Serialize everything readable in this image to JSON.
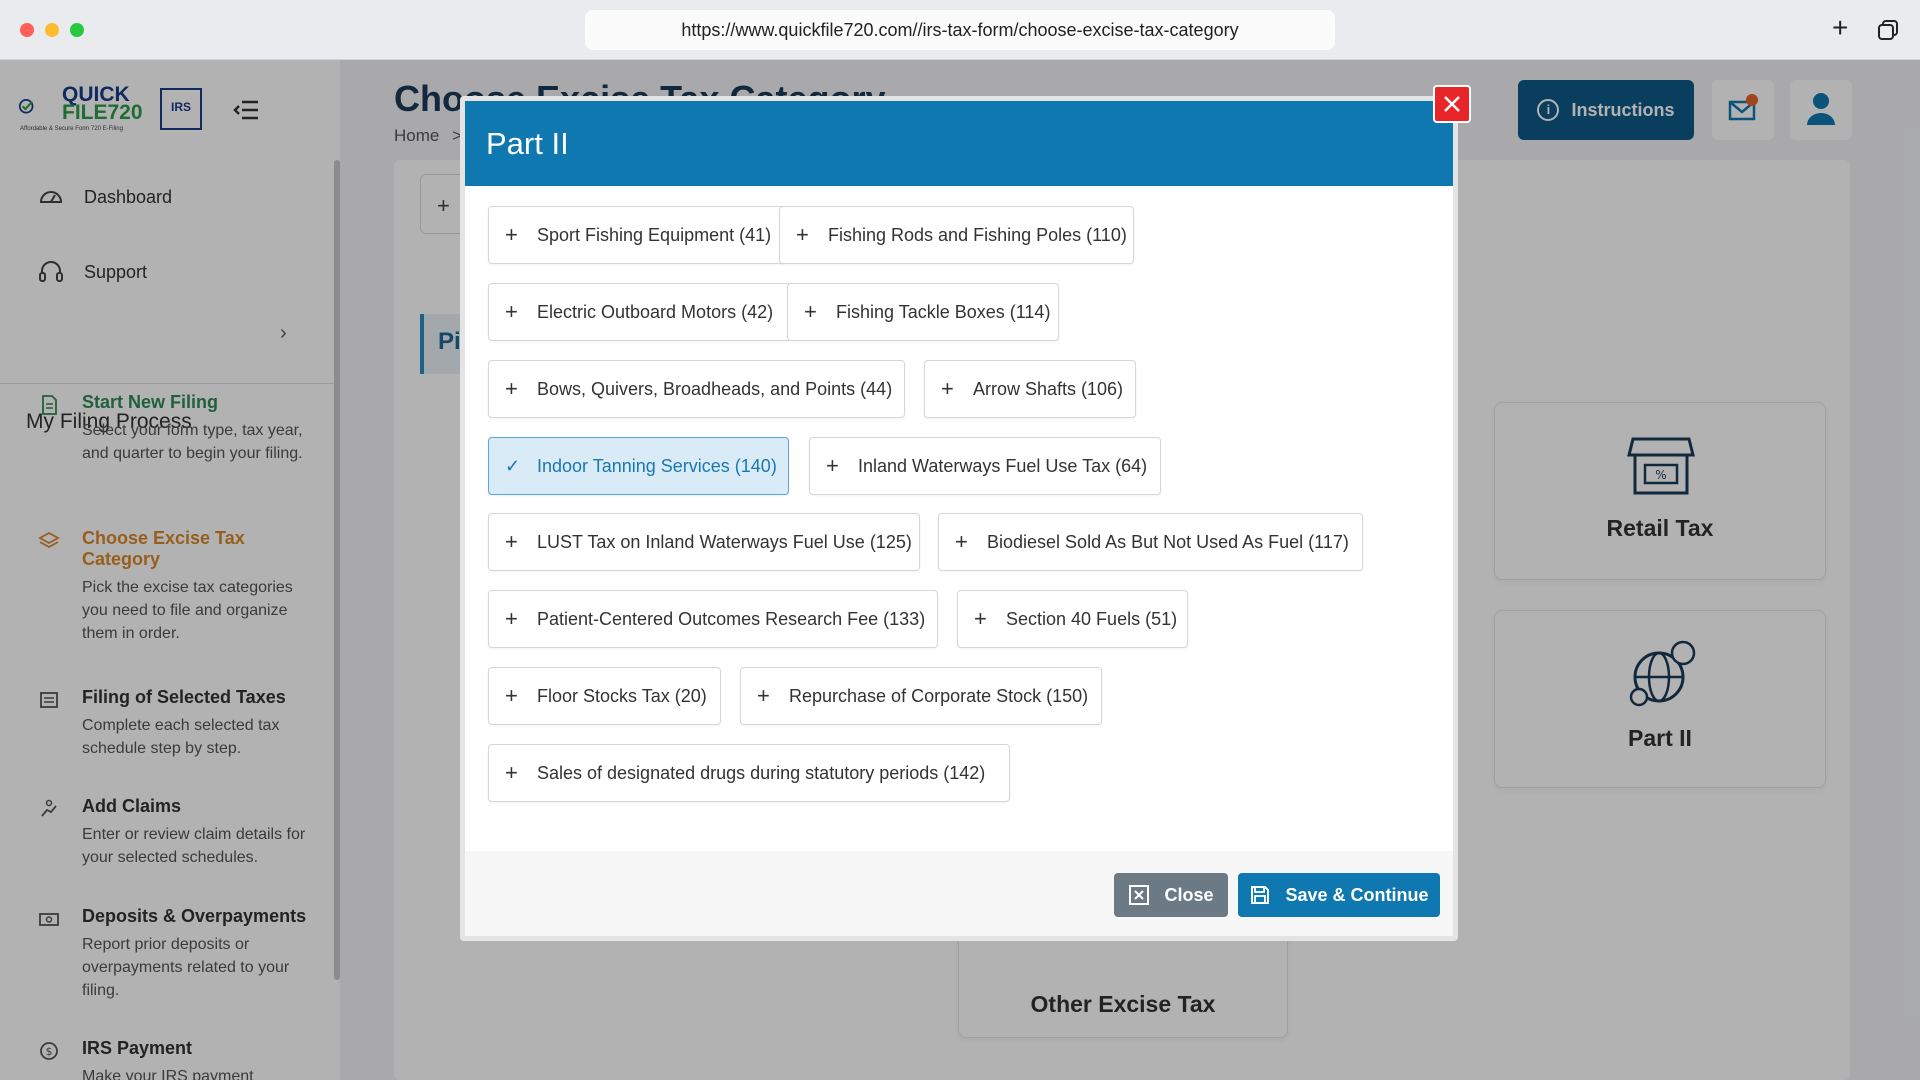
{
  "browser": {
    "url": "https://www.quickfile720.com//irs-tax-form/choose-excise-tax-category"
  },
  "brand": {
    "logo_line1": "QUICK",
    "logo_line2": "FILE720",
    "logo_tagline": "Affordable & Secure Form 720 E-Filing",
    "irs_badge": "IRS"
  },
  "sidebar": {
    "items": [
      {
        "label": "Dashboard",
        "icon": "dashboard-icon"
      },
      {
        "label": "Support",
        "icon": "headset-icon"
      }
    ],
    "process_title": "My Filing Process",
    "steps": [
      {
        "title": "Start New Filing",
        "desc": "Select your form type, tax year, and quarter to begin your filing.",
        "state": "done"
      },
      {
        "title": "Choose Excise Tax Category",
        "desc": "Pick the excise tax categories you need to file and organize them in order.",
        "state": "active"
      },
      {
        "title": "Filing of Selected Taxes",
        "desc": "Complete each selected tax schedule step by step.",
        "state": "pending"
      },
      {
        "title": "Add Claims",
        "desc": "Enter or review claim details for your selected schedules.",
        "state": "pending"
      },
      {
        "title": "Deposits & Overpayments",
        "desc": "Report prior deposits or overpayments related to your filing.",
        "state": "pending"
      },
      {
        "title": "IRS Payment",
        "desc": "Make your IRS payment",
        "state": "pending"
      }
    ]
  },
  "header": {
    "page_title": "Choose Excise Tax Category",
    "breadcrumb_home": "Home",
    "breadcrumb_sep": ">",
    "instructions_label": "Instructions"
  },
  "background": {
    "plus": "+",
    "pi": "Pi",
    "cards": [
      {
        "label": "Retail Tax"
      },
      {
        "label": "Part II"
      },
      {
        "label": "Other Excise Tax"
      }
    ]
  },
  "modal": {
    "title": "Part II",
    "options": [
      {
        "label": "Sport Fishing Equipment (41)",
        "selected": false
      },
      {
        "label": "Fishing Rods and Fishing Poles (110)",
        "selected": false
      },
      {
        "label": "Electric Outboard Motors (42)",
        "selected": false
      },
      {
        "label": "Fishing Tackle Boxes (114)",
        "selected": false
      },
      {
        "label": "Bows, Quivers, Broadheads, and Points (44)",
        "selected": false
      },
      {
        "label": "Arrow Shafts (106)",
        "selected": false
      },
      {
        "label": "Indoor Tanning Services (140)",
        "selected": true
      },
      {
        "label": "Inland Waterways Fuel Use Tax (64)",
        "selected": false
      },
      {
        "label": "LUST Tax on Inland Waterways Fuel Use (125)",
        "selected": false
      },
      {
        "label": "Biodiesel Sold As But Not Used As Fuel (117)",
        "selected": false
      },
      {
        "label": "Patient-Centered Outcomes Research Fee (133)",
        "selected": false
      },
      {
        "label": "Section 40 Fuels (51)",
        "selected": false
      },
      {
        "label": "Floor Stocks Tax (20)",
        "selected": false
      },
      {
        "label": "Repurchase of Corporate Stock (150)",
        "selected": false
      },
      {
        "label": "Sales of designated drugs during statutory periods (142)",
        "selected": false
      }
    ],
    "close_label": "Close",
    "save_label": "Save & Continue"
  },
  "colors": {
    "brand_blue": "#0f78b0",
    "selected_bg": "#d8ebf6",
    "active_step": "#d9892b",
    "done_step": "#2e8b57",
    "close_x": "#e8262a"
  }
}
